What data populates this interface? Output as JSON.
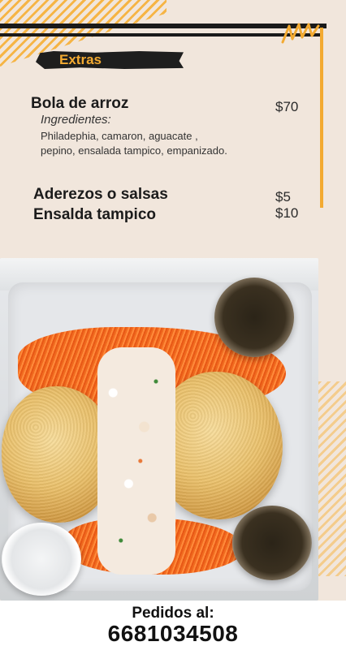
{
  "section": {
    "title": "Extras"
  },
  "items": [
    {
      "name": "Bola de arroz",
      "price": "$70",
      "ingredients_title": "Ingredientes:",
      "ingredients_line1": "Philadephia, camaron, aguacate ,",
      "ingredients_line2": "pepino, ensalada tampico, empanizado."
    },
    {
      "name": "Aderezos o salsas",
      "price": "$5"
    },
    {
      "name": "Ensalda tampico",
      "price": "$10"
    }
  ],
  "footer": {
    "label": "Pedidos al:",
    "phone": "6681034508"
  },
  "colors": {
    "accent": "#f3aa31",
    "background": "#f1e6dc",
    "text": "#1b1b1b"
  }
}
